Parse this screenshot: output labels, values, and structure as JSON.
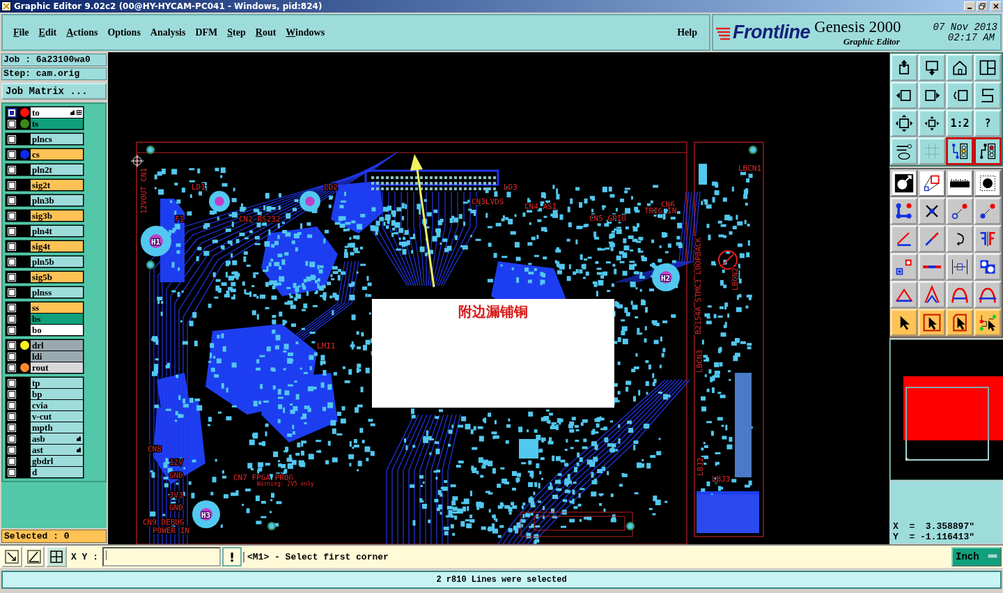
{
  "window": {
    "title": "Graphic Editor 9.02c2 (00@HY-HYCAM-PC041 - Windows, pid:824)"
  },
  "menu": [
    {
      "label": "File",
      "underlined": true
    },
    {
      "label": "Edit",
      "underlined": true
    },
    {
      "label": "Actions",
      "underlined": true
    },
    {
      "label": "Options",
      "underlined": false
    },
    {
      "label": "Analysis",
      "underlined": false
    },
    {
      "label": "DFM",
      "underlined": false
    },
    {
      "label": "Step",
      "underlined": true
    },
    {
      "label": "Rout",
      "underlined": true
    },
    {
      "label": "Windows",
      "underlined": true
    },
    {
      "label": "Help",
      "underlined": false
    }
  ],
  "brand": {
    "logo": "Frontline",
    "product": "Genesis 2000",
    "subtitle": "Graphic Editor",
    "date": "07 Nov 2013",
    "time": "02:17 AM"
  },
  "job": {
    "job": "Job :  6a23100wa0",
    "step": "Step: cam.orig",
    "matrix_button": "Job Matrix ..."
  },
  "layer_groups": [
    {
      "layers": [
        {
          "name": "to",
          "color": "#ffffff",
          "marker": {
            "color": "#ff1010"
          },
          "selected": true,
          "hand": true,
          "grid": true
        },
        {
          "name": "ts",
          "color": "#10a07c",
          "marker": {
            "color": "#3a8a1a"
          },
          "selected": false,
          "hand": false,
          "grid": false
        }
      ]
    },
    {
      "layers": [
        {
          "name": "plncs",
          "color": "#9edcdc",
          "selected": false,
          "hand": false,
          "grid": false
        }
      ]
    },
    {
      "layers": [
        {
          "name": "cs",
          "color": "#ffc255",
          "marker": {
            "color": "#0a2af0"
          },
          "selected": false,
          "hand": false,
          "grid": false
        }
      ]
    },
    {
      "layers": [
        {
          "name": "pln2t",
          "color": "#9edcdc",
          "selected": false,
          "hand": false,
          "grid": false
        }
      ]
    },
    {
      "layers": [
        {
          "name": "sig2t",
          "color": "#ffc255",
          "selected": false,
          "hand": false,
          "grid": false
        }
      ]
    },
    {
      "layers": [
        {
          "name": "pln3b",
          "color": "#9edcdc",
          "selected": false,
          "hand": false,
          "grid": false
        }
      ]
    },
    {
      "layers": [
        {
          "name": "sig3b",
          "color": "#ffc255",
          "selected": false,
          "hand": false,
          "grid": false
        }
      ]
    },
    {
      "layers": [
        {
          "name": "pln4t",
          "color": "#9edcdc",
          "selected": false,
          "hand": false,
          "grid": false
        }
      ]
    },
    {
      "layers": [
        {
          "name": "sig4t",
          "color": "#ffc255",
          "selected": false,
          "hand": false,
          "grid": false
        }
      ]
    },
    {
      "layers": [
        {
          "name": "pln5b",
          "color": "#9edcdc",
          "selected": false,
          "hand": false,
          "grid": false
        }
      ]
    },
    {
      "layers": [
        {
          "name": "sig5b",
          "color": "#ffc255",
          "selected": false,
          "hand": false,
          "grid": false
        }
      ]
    },
    {
      "layers": [
        {
          "name": "plnss",
          "color": "#9edcdc",
          "selected": false,
          "hand": false,
          "grid": false
        }
      ]
    },
    {
      "layers": [
        {
          "name": "ss",
          "color": "#ffc255",
          "selected": false,
          "hand": false,
          "grid": false
        },
        {
          "name": "bs",
          "color": "#10a07c",
          "selected": false,
          "hand": false,
          "grid": false
        },
        {
          "name": "bo",
          "color": "#ffffff",
          "selected": false,
          "hand": false,
          "grid": false
        }
      ]
    },
    {
      "layers": [
        {
          "name": "drl",
          "color": "#98aab0",
          "marker": {
            "color": "#ffee22"
          },
          "selected": false,
          "hand": false,
          "grid": false
        },
        {
          "name": "ldi",
          "color": "#98aab0",
          "selected": false,
          "hand": false,
          "grid": false
        },
        {
          "name": "rout",
          "color": "#d8d8d8",
          "marker": {
            "color": "#ff8c2a"
          },
          "selected": false,
          "hand": false,
          "grid": false
        }
      ]
    },
    {
      "layers": [
        {
          "name": "tp",
          "color": "#9edcdc",
          "selected": false,
          "hand": false,
          "grid": false
        },
        {
          "name": "bp",
          "color": "#9edcdc",
          "selected": false,
          "hand": false,
          "grid": false
        },
        {
          "name": "cvia",
          "color": "#9edcdc",
          "selected": false,
          "hand": false,
          "grid": false
        },
        {
          "name": "v-cut",
          "color": "#9edcdc",
          "selected": false,
          "hand": false,
          "grid": false
        },
        {
          "name": "mpth",
          "color": "#9edcdc",
          "selected": false,
          "hand": false,
          "grid": false
        },
        {
          "name": "asb",
          "color": "#9edcdc",
          "selected": false,
          "hand": true,
          "grid": false
        },
        {
          "name": "ast",
          "color": "#9edcdc",
          "selected": false,
          "hand": true,
          "grid": false
        },
        {
          "name": "gbdrl",
          "color": "#9edcdc",
          "selected": false,
          "hand": false,
          "grid": false
        },
        {
          "name": "d",
          "color": "#9edcdc",
          "selected": false,
          "hand": false,
          "grid": false
        }
      ]
    }
  ],
  "selected_count": "Selected : 0",
  "canvas": {
    "labels": [
      "LD1",
      "LD2",
      "LD3",
      "CN2 RS232",
      "CN3LVDS",
      "CN4 ASI",
      "CN5 GPIO",
      "CN6",
      "TRIG IN",
      "F1",
      "H1",
      "H2",
      "H3",
      "12VOUT CN1",
      "LMI1",
      "CN8",
      "12V",
      "GND",
      "3V3",
      "GND",
      "CN7 FPGA PROG",
      "Warning: 2V5 only",
      "CN9 DEBUG",
      "POWER IN",
      "LBCN1",
      "LBCN2",
      "LBCN3",
      "B2154A STMC3 LOOPBACK",
      "LBJ2",
      "LBJ3"
    ],
    "annotation": "附边漏铺铜"
  },
  "view_toolbar": [
    {
      "selected": false
    },
    {
      "selected": false
    },
    {
      "selected": false
    },
    {
      "selected": false
    },
    {
      "selected": false
    },
    {
      "selected": false
    },
    {
      "selected": false
    },
    {
      "selected": false
    },
    {
      "selected": false
    },
    {
      "selected": false
    },
    {
      "selected": false,
      "label": "1:2"
    },
    {
      "selected": false,
      "label": "?"
    },
    {
      "selected": false
    },
    {
      "selected": false
    },
    {
      "selected": true
    },
    {
      "selected": true
    }
  ],
  "coordinates": {
    "x": "X  =  3.358897\"",
    "y": "Y  = -1.116413\""
  },
  "command_bar": {
    "xy_label": "X Y :",
    "confirm_button": "!",
    "prompt": "<M1> - Select first corner",
    "units": "Inch"
  },
  "status": "2 r810 Lines were selected"
}
